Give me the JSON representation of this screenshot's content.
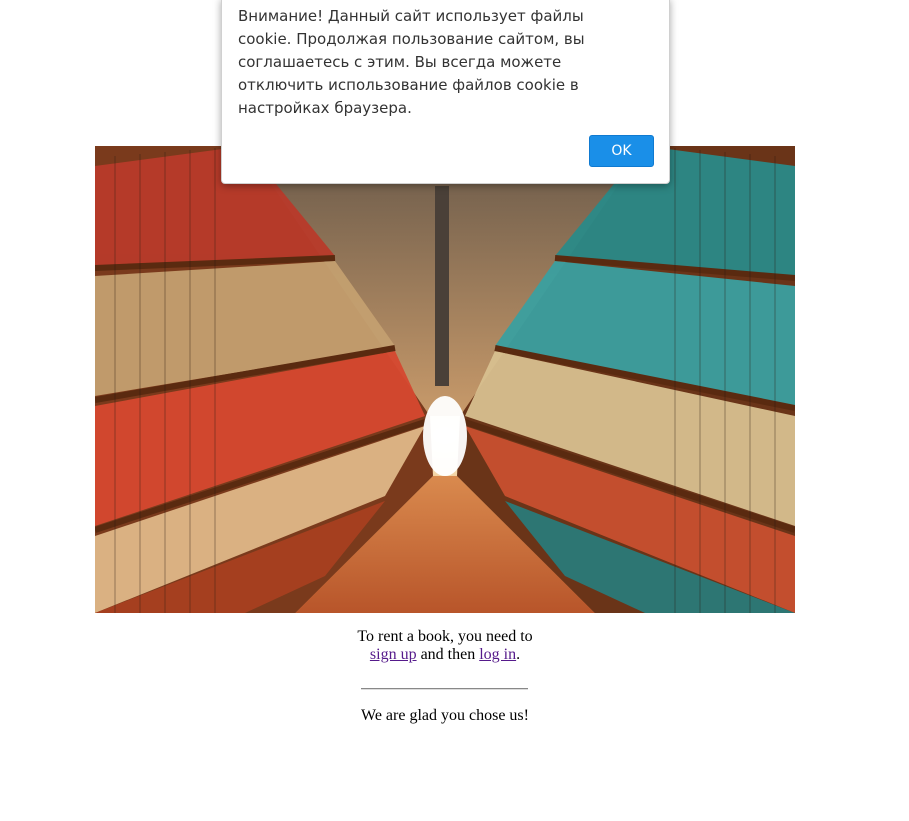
{
  "cookie_banner": {
    "message": "Внимание! Данный сайт использует файлы cookie. Продолжая пользование сайтом, вы соглашаетесь с этим. Вы всегда можете отключить использование файлов cookie в настройках браузера.",
    "ok_label": "OK",
    "button_color": "#1a8fe8"
  },
  "hero": {
    "icon": "library-bookshelves-image"
  },
  "info": {
    "line1": "To rent a book, you need to",
    "signup_link": "sign up",
    "middle": " and then ",
    "login_link": "log in",
    "end": "."
  },
  "footer": {
    "glad_text": "We are glad you chose us!"
  },
  "colors": {
    "link": "#551a8b"
  }
}
